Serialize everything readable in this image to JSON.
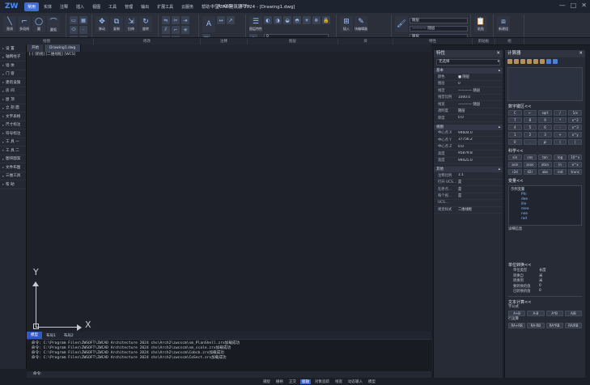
{
  "app": {
    "title": "中望CAD建筑版 2024 - [Drawing1.dwg]",
    "logo": "ZW"
  },
  "menu_tabs": [
    "常用",
    "实体",
    "注释",
    "插入",
    "视图",
    "工具",
    "管理",
    "输出",
    "扩展工具",
    "云服务",
    "帮助",
    "ArcGIS",
    "APP+"
  ],
  "window_buttons": [
    "minimize-icon",
    "maximize-icon",
    "close-icon"
  ],
  "ribbon": {
    "labels": [
      "绘图",
      "修改",
      "注释",
      "图层",
      "块",
      "特性",
      "剪贴板",
      "组"
    ],
    "big_buttons": [
      "直线",
      "多段线",
      "圆",
      "圆弧",
      "移动",
      "复制",
      "拉伸",
      "旋转",
      "图层特性",
      "插入",
      "块编辑器",
      "特性匹配",
      "粘贴",
      "新建组"
    ],
    "layer_dropdown": "0",
    "color_dropdown": "随层",
    "linetype_dropdown": "———— 随层",
    "lineweight_dropdown": "随层"
  },
  "sidebar": {
    "items": [
      "设 置",
      "轴网柱子",
      "墙 体",
      "门 窗",
      "建筑设施",
      "房 间",
      "屋 顶",
      "立 剖 面",
      "文字表格",
      "尺寸标注",
      "符号标注",
      "工 具 一",
      "工 具 二",
      "图块图案",
      "文件布图",
      "三维工具",
      "帮 助"
    ]
  },
  "doc_tabs": [
    "开始",
    "Drawing1.dwg"
  ],
  "viewport": {
    "label": "[-] [俯视] [二维线框] [WCS]",
    "ucs_x": "X",
    "ucs_y": "Y"
  },
  "layout_tabs": [
    "模型",
    "布局1",
    "布局2"
  ],
  "command_history": [
    "命令: C:\\Program Files\\ZWSOFT\\ZWCAD Architecture 2024 chs\\Arch2\\zwcscm\\sm_PlanShell.zrx加载成功",
    "命令: C:\\Program Files\\ZWSOFT\\ZWCAD Architecture 2024 chs\\Arch2\\zwcscm\\sm_scale.zrx加载成功",
    "命令: C:\\Program Files\\ZWSOFT\\ZWCAD Architecture 2024 chs\\Arch2\\zwcscm\\Cobcb.zrx加载成功",
    "命令: C:\\Program Files\\ZWSOFT\\ZWCAD Architecture 2024 chs\\Arch2\\zwcscm\\CoSect.zrx加载成功"
  ],
  "command_prompt": "命令:",
  "statusbar": [
    "捕捉",
    "栅格",
    "正交",
    "极轴",
    "对象追踪",
    "线宽",
    "动态输入",
    "模型"
  ],
  "properties": {
    "title": "特性",
    "selection": "无选择",
    "sections": {
      "general": "基本",
      "view": "视图",
      "misc": "其他"
    },
    "general_rows": [
      {
        "name": "颜色",
        "value": "■ 随层"
      },
      {
        "name": "图层",
        "value": "0"
      },
      {
        "name": "线型",
        "value": "———— 随层"
      },
      {
        "name": "线型比例",
        "value": "1000.0"
      },
      {
        "name": "线宽",
        "value": "———— 随层"
      },
      {
        "name": "透明度",
        "value": "随层"
      },
      {
        "name": "厚度",
        "value": "0.0"
      }
    ],
    "view_rows": [
      {
        "name": "中心点 X",
        "value": "94604.0"
      },
      {
        "name": "中心点 Y",
        "value": "37756.2"
      },
      {
        "name": "中心点 Z",
        "value": "0.0"
      },
      {
        "name": "高度",
        "value": "95879.8"
      },
      {
        "name": "宽度",
        "value": "99425.0"
      }
    ],
    "misc_rows": [
      {
        "name": "注释比例",
        "value": "1:1"
      },
      {
        "name": "打开 UCS...",
        "value": "是"
      },
      {
        "name": "在原点...",
        "value": "是"
      },
      {
        "name": "每个视...",
        "value": "是"
      },
      {
        "name": "UCS...",
        "value": ""
      },
      {
        "name": "视觉样式",
        "value": "二维线框"
      }
    ]
  },
  "calculator": {
    "title": "计算器",
    "keypad_title": "数字键区<<",
    "keys": [
      "C",
      "←",
      "sqrt",
      "/",
      "1/x",
      "7",
      "8",
      "9",
      "*",
      "x^2",
      "4",
      "5",
      "6",
      "-",
      "x^3",
      "1",
      "2",
      "3",
      "+",
      "x^y",
      "0",
      ".",
      "pi",
      "(",
      ")",
      "=",
      "",
      "",
      "",
      ""
    ],
    "sci_title": "科学<<",
    "sci_keys": [
      "sin",
      "cos",
      "tan",
      "log",
      "10^x",
      "asin",
      "acos",
      "atan",
      "ln",
      "e^x",
      "r2d",
      "d2r",
      "abs",
      "rnd",
      "trunc"
    ],
    "var_title": "变量<<",
    "var_tree": [
      "示例变量",
      "Phi",
      "dee",
      "ille",
      "mee",
      "nee",
      "rad"
    ],
    "var_footer": "详细信息",
    "unit_title": "单位转换<<",
    "unit_rows": [
      {
        "name": "单位类型",
        "value": "长度"
      },
      {
        "name": "转换自",
        "value": "米"
      },
      {
        "name": "转换到",
        "value": "米"
      },
      {
        "name": "要转换的值",
        "value": "0"
      },
      {
        "name": "已转换的值",
        "value": "0"
      }
    ],
    "text_title": "文本计算<<",
    "text_sub1": "字公式",
    "text_btns1": [
      "A+B",
      "A-B",
      "A*B",
      "A/B"
    ],
    "text_sub2": "行运算",
    "text_btns2": [
      "RA+RB",
      "RA-RB",
      "RA*RB",
      "RA/RB"
    ]
  },
  "colors": {
    "accent": "#3d6dd8",
    "canvas": "#1e2129",
    "panel": "#262b36"
  }
}
